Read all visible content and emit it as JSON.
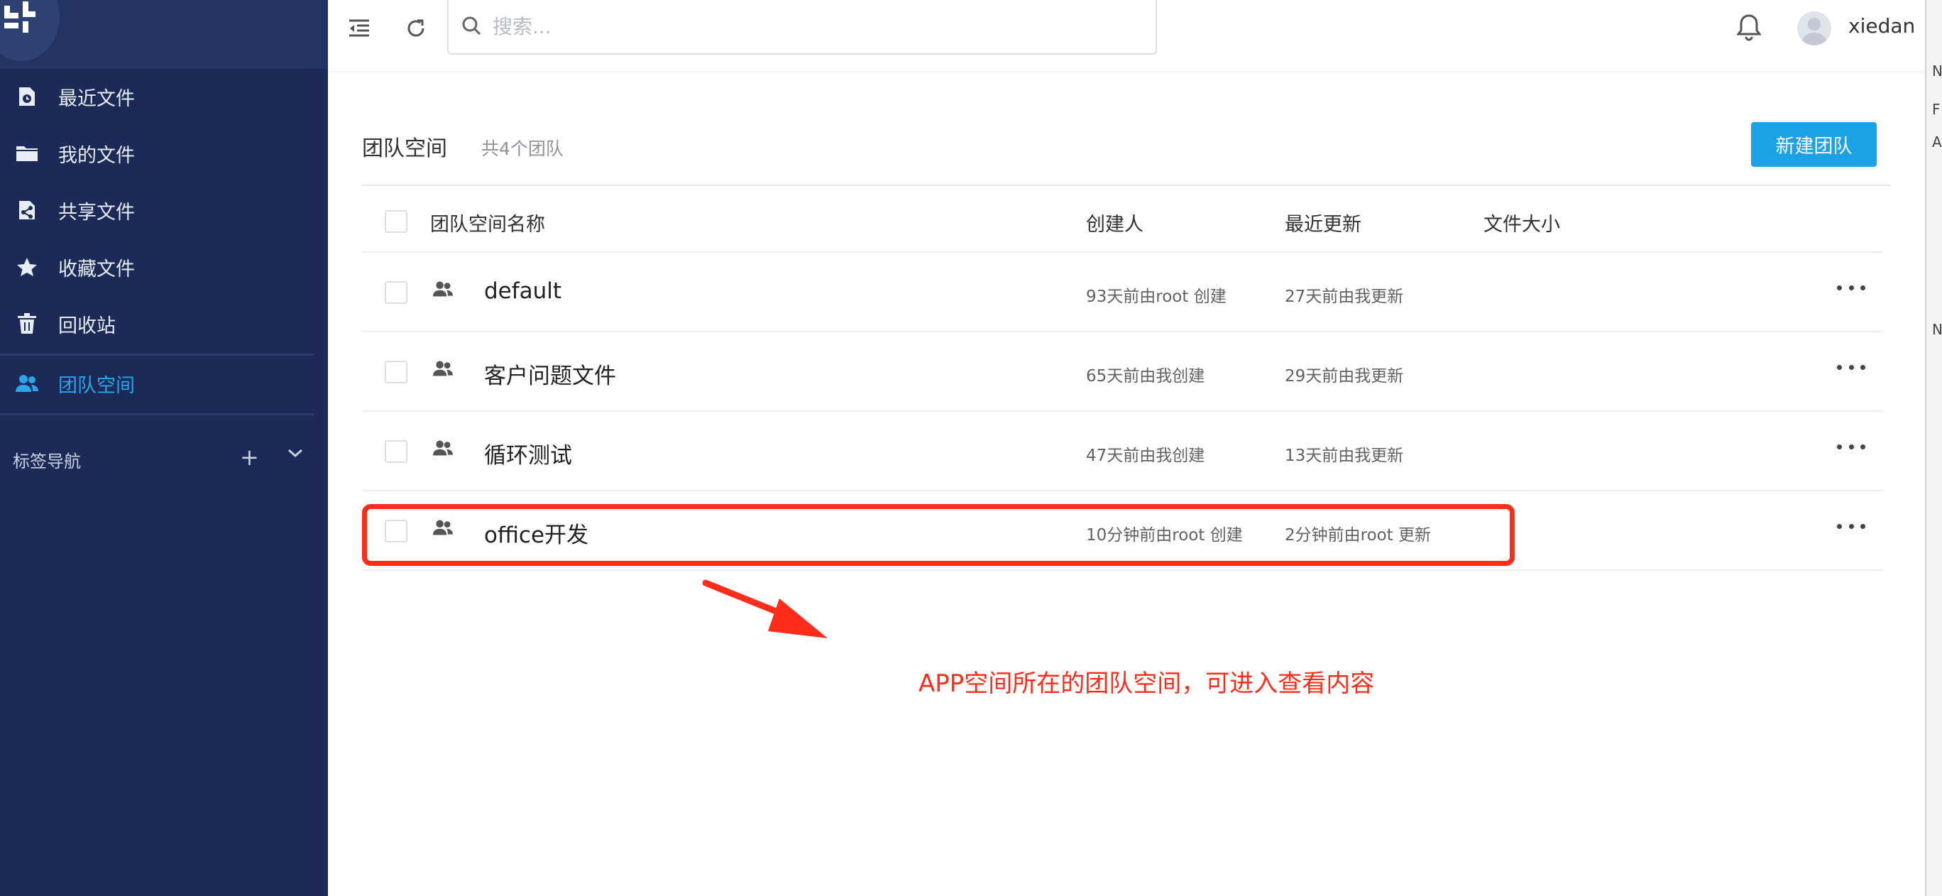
{
  "search": {
    "placeholder": "搜索..."
  },
  "user": {
    "name": "xiedan"
  },
  "sidebar": {
    "items": [
      {
        "label": "最近文件",
        "icon": "recent-file-icon"
      },
      {
        "label": "我的文件",
        "icon": "folder-icon"
      },
      {
        "label": "共享文件",
        "icon": "share-file-icon"
      },
      {
        "label": "收藏文件",
        "icon": "star-icon"
      },
      {
        "label": "回收站",
        "icon": "trash-icon"
      },
      {
        "label": "团队空间",
        "icon": "team-icon",
        "active": true
      }
    ],
    "tag_nav_label": "标签导航",
    "tag_add": "+"
  },
  "main": {
    "title": "团队空间",
    "count": "共4个团队",
    "new_team_button": "新建团队",
    "columns": {
      "name": "团队空间名称",
      "creator": "创建人",
      "updated": "最近更新",
      "size": "文件大小"
    },
    "rows": [
      {
        "name": "default",
        "creator": "93天前由root 创建",
        "updated": "27天前由我更新",
        "size": ""
      },
      {
        "name": "客户问题文件",
        "creator": "65天前由我创建",
        "updated": "29天前由我更新",
        "size": ""
      },
      {
        "name": "循环测试",
        "creator": "47天前由我创建",
        "updated": "13天前由我更新",
        "size": ""
      },
      {
        "name": "office开发",
        "creator": "10分钟前由root 创建",
        "updated": "2分钟前由root 更新",
        "size": ""
      }
    ]
  },
  "annotation": {
    "text": "APP空间所在的团队空间，可进入查看内容"
  },
  "edge_strip": {
    "letters": [
      "N",
      "F",
      "A",
      "N"
    ]
  },
  "colors": {
    "sidebar_bg": "#1c2a57",
    "accent": "#1aa1e6",
    "active_nav": "#2aa4ea",
    "annotation_red": "#ff2d1a"
  }
}
